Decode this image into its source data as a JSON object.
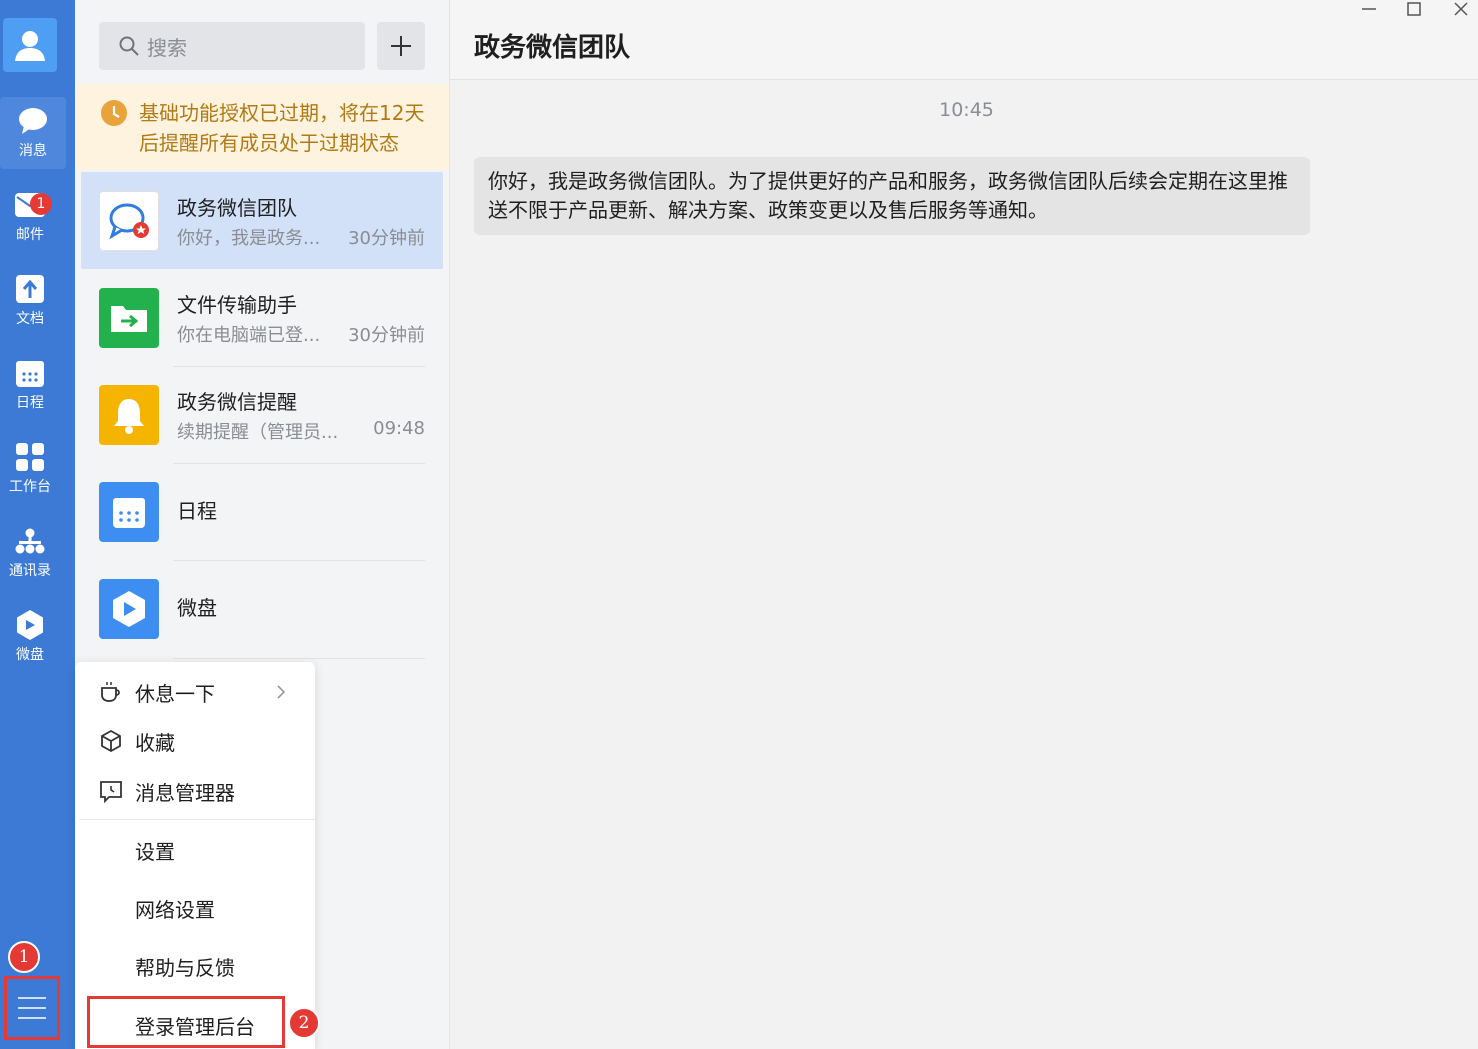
{
  "nav": {
    "items": [
      {
        "id": "messages",
        "label": "消息"
      },
      {
        "id": "mail",
        "label": "邮件",
        "badge": "1"
      },
      {
        "id": "docs",
        "label": "文档"
      },
      {
        "id": "schedule",
        "label": "日程"
      },
      {
        "id": "workbench",
        "label": "工作台"
      },
      {
        "id": "contacts",
        "label": "通讯录"
      },
      {
        "id": "drive",
        "label": "微盘"
      }
    ],
    "marker": "1"
  },
  "search": {
    "placeholder": "搜索"
  },
  "notice": {
    "text": "基础功能授权已过期，将在12天后提醒所有成员处于过期状态"
  },
  "conversations": [
    {
      "name": "政务微信团队",
      "preview": "你好，我是政务...",
      "time": "30分钟前"
    },
    {
      "name": "文件传输助手",
      "preview": "你在电脑端已登...",
      "time": "30分钟前"
    },
    {
      "name": "政务微信提醒",
      "preview": "续期提醒（管理员...",
      "time": "09:48"
    },
    {
      "name": "日程",
      "preview": "",
      "time": ""
    },
    {
      "name": "微盘",
      "preview": "",
      "time": ""
    }
  ],
  "menu": {
    "items": [
      {
        "label": "休息一下",
        "icon": "coffee-icon"
      },
      {
        "label": "收藏",
        "icon": "cube-icon"
      },
      {
        "label": "消息管理器",
        "icon": "message-manager-icon"
      },
      {
        "label": "设置"
      },
      {
        "label": "网络设置"
      },
      {
        "label": "帮助与反馈"
      },
      {
        "label": "登录管理后台"
      }
    ],
    "marker": "2"
  },
  "chat": {
    "title": "政务微信团队",
    "timestamp": "10:45",
    "message": "你好，我是政务微信团队。为了提供更好的产品和服务，政务微信团队后续会定期在这里推送不限于产品更新、解决方案、政策变更以及售后服务等通知。"
  },
  "colors": {
    "nav_bg": "#3d7ad6",
    "accent_red": "#e53935",
    "notice_text": "#b27a15",
    "active_conv": "#d2e1f7"
  }
}
